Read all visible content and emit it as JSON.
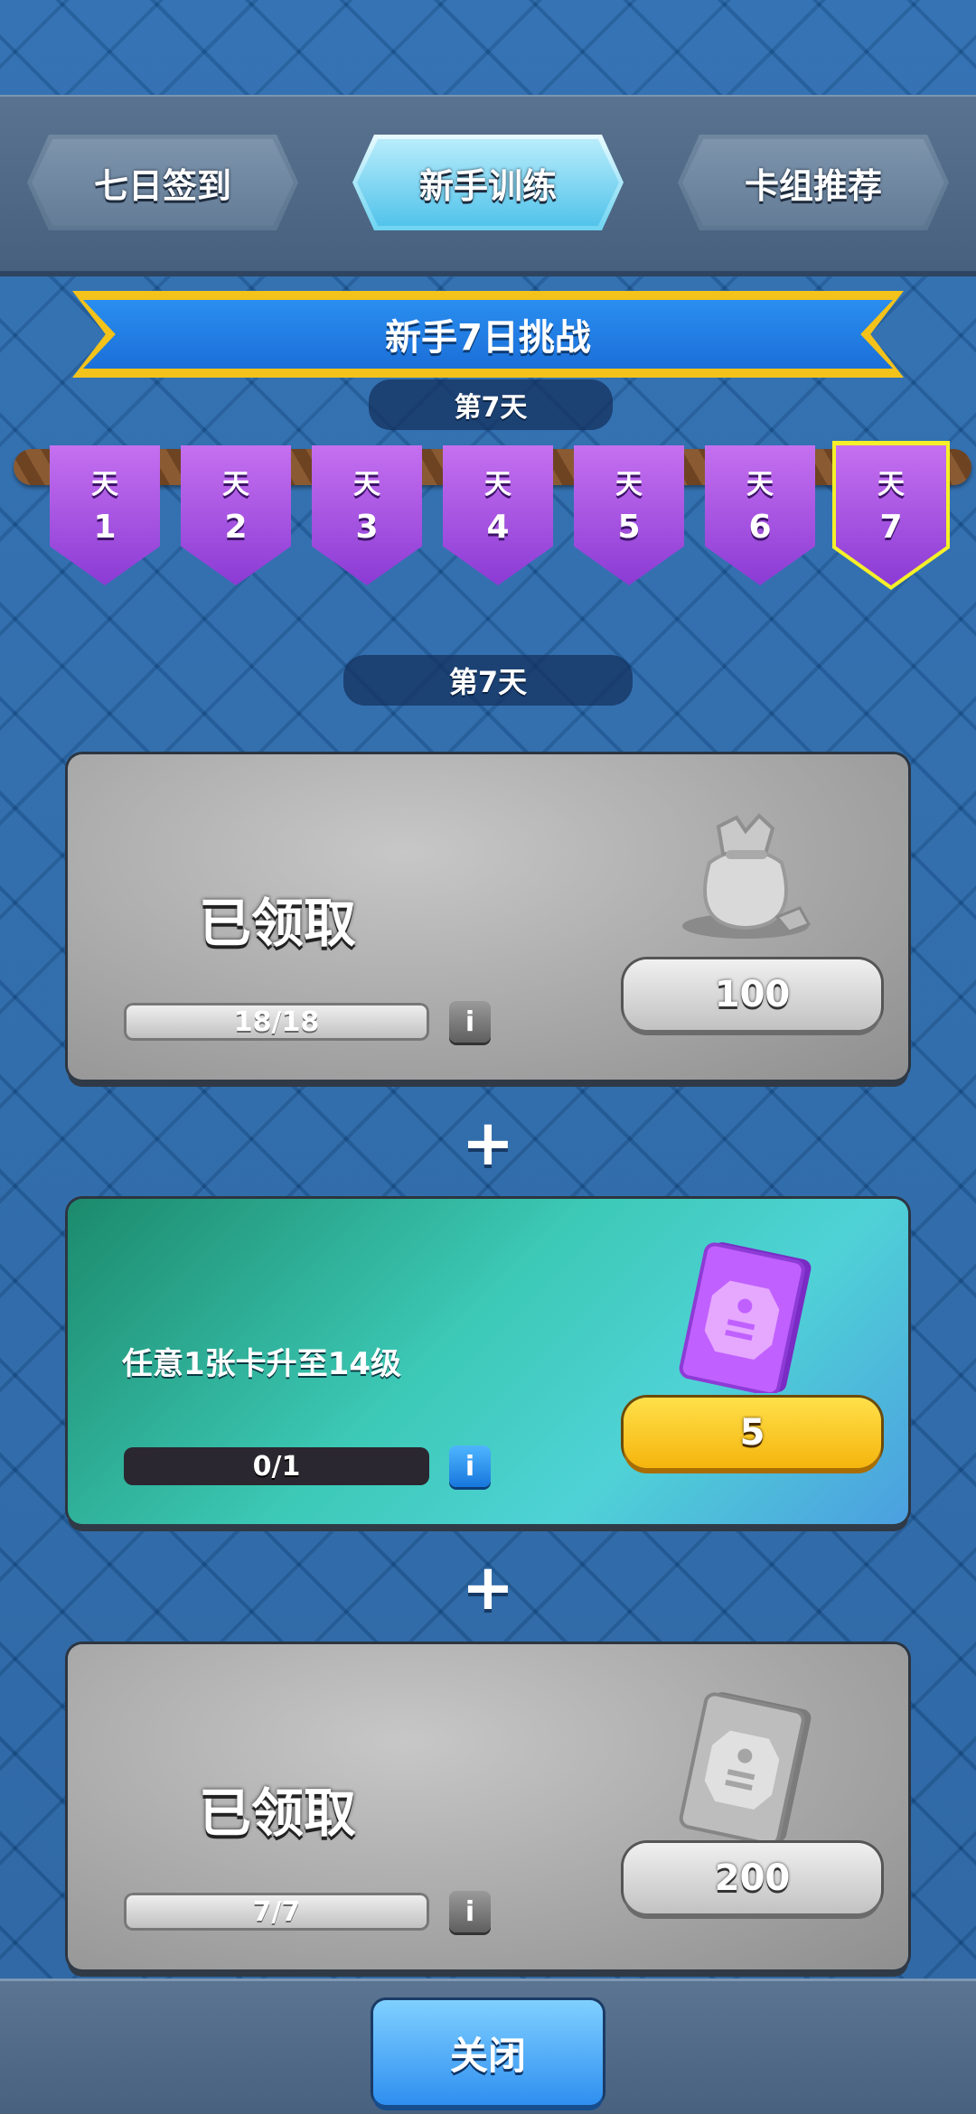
{
  "tabs": [
    {
      "label": "七日签到",
      "active": false
    },
    {
      "label": "新手训练",
      "active": true
    },
    {
      "label": "卡组推荐",
      "active": false
    }
  ],
  "banner": {
    "title": "新手7日挑战",
    "current_day": "第7天"
  },
  "days": [
    {
      "label": "天",
      "num": "1"
    },
    {
      "label": "天",
      "num": "2"
    },
    {
      "label": "天",
      "num": "3"
    },
    {
      "label": "天",
      "num": "4"
    },
    {
      "label": "天",
      "num": "5"
    },
    {
      "label": "天",
      "num": "6"
    },
    {
      "label": "天",
      "num": "7",
      "selected": true
    }
  ],
  "section_day": "第7天",
  "tasks": [
    {
      "status": "已领取",
      "progress": "18/18",
      "reward": "100",
      "reward_icon": "gold-bag-icon"
    },
    {
      "description": "任意1张卡升至14级",
      "progress": "0/1",
      "reward": "5",
      "reward_icon": "purple-card-icon"
    },
    {
      "status": "已领取",
      "progress": "7/7",
      "reward": "200",
      "reward_icon": "gray-card-icon"
    }
  ],
  "plus_symbol": "+",
  "info_symbol": "i",
  "close_label": "关闭",
  "colors": {
    "accent_gold": "#f5b50d",
    "banner_blue": "#1b6fd8",
    "flag_purple": "#8b3bd4"
  }
}
